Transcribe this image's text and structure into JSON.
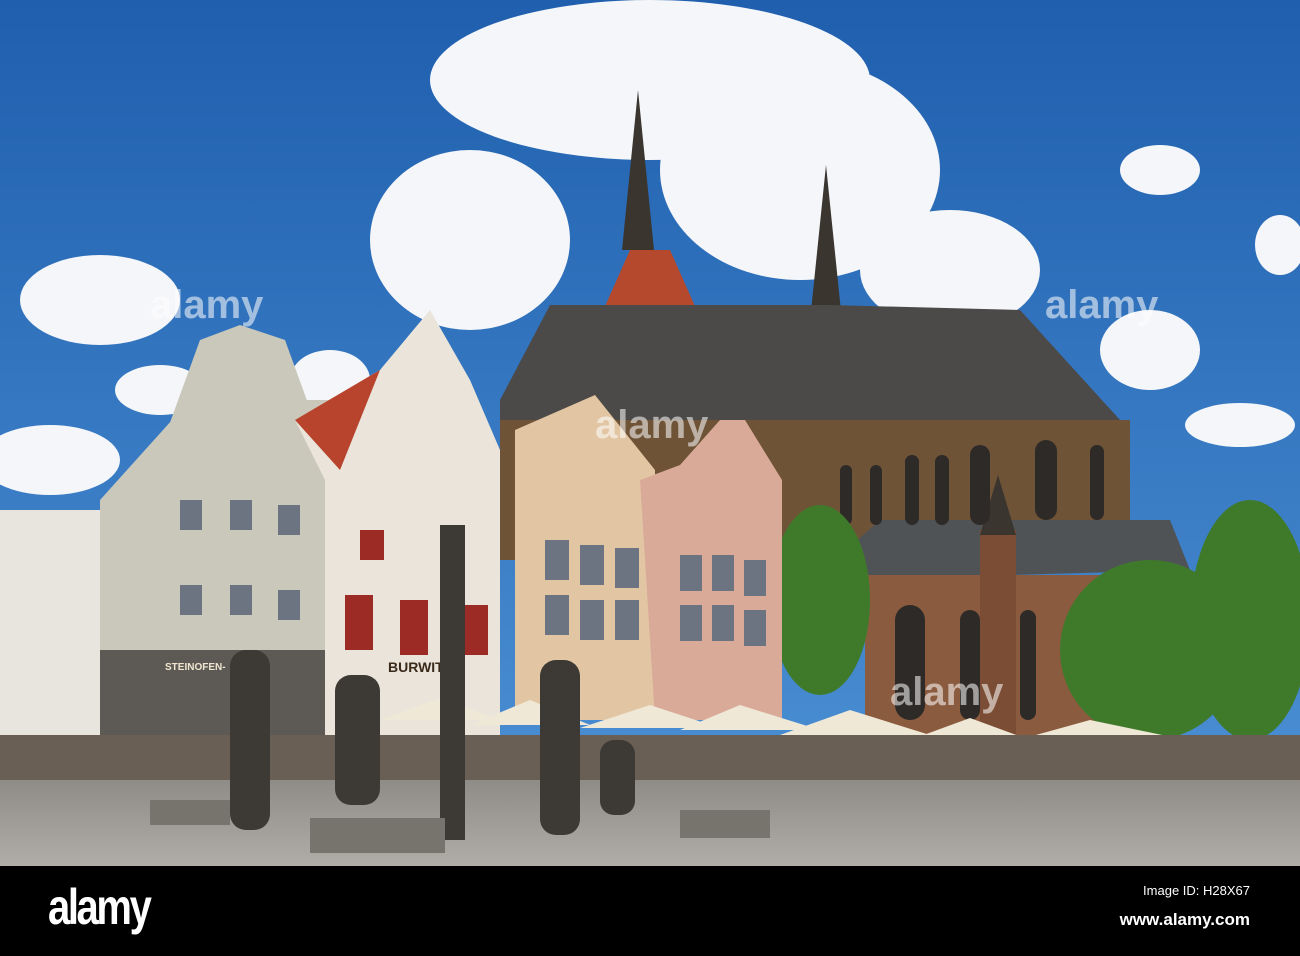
{
  "photo": {
    "signs": {
      "bakery": "STEINOFEN-",
      "shop": "BURWITZ"
    },
    "watermark_text": "alamy"
  },
  "footer": {
    "logo": "alamy",
    "image_id": "Image ID: H28X67",
    "website": "www.alamy.com"
  }
}
